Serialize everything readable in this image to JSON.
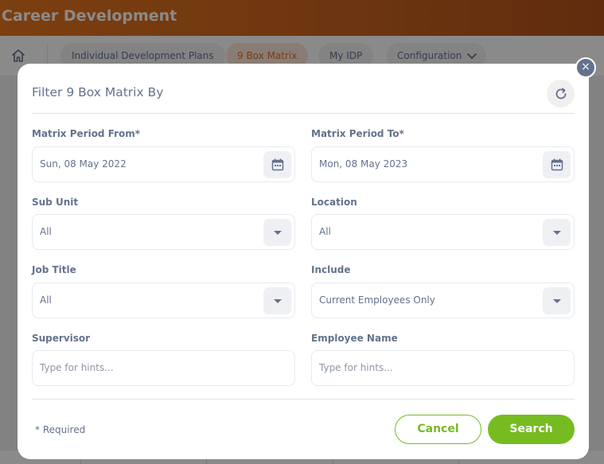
{
  "app": {
    "title": "Career Development"
  },
  "nav": {
    "tabs": [
      {
        "label": "Individual Development Plans"
      },
      {
        "label": "9 Box Matrix"
      },
      {
        "label": "My IDP"
      },
      {
        "label": "Configuration"
      }
    ],
    "active_tab": "9 Box Matrix"
  },
  "modal": {
    "title": "Filter 9 Box Matrix By",
    "fields": {
      "period_from": {
        "label": "Matrix Period From*",
        "value": "Sun, 08 May 2022"
      },
      "period_to": {
        "label": "Matrix Period To*",
        "value": "Mon, 08 May 2023"
      },
      "sub_unit": {
        "label": "Sub Unit",
        "value": "All"
      },
      "location": {
        "label": "Location",
        "value": "All"
      },
      "job_title": {
        "label": "Job Title",
        "value": "All"
      },
      "include": {
        "label": "Include",
        "value": "Current Employees Only"
      },
      "supervisor": {
        "label": "Supervisor",
        "placeholder": "Type for hints..."
      },
      "employee_name": {
        "label": "Employee Name",
        "placeholder": "Type for hints..."
      }
    },
    "required_note": "* Required",
    "cancel_label": "Cancel",
    "search_label": "Search",
    "close_glyph": "×"
  },
  "colors": {
    "brand_orange": "#e5751c",
    "accent_green": "#76bc21",
    "text": "#64728c"
  },
  "icons": [
    "home-icon",
    "chevron-down-icon",
    "close-icon",
    "refresh-icon",
    "calendar-icon",
    "caret-down-icon"
  ]
}
